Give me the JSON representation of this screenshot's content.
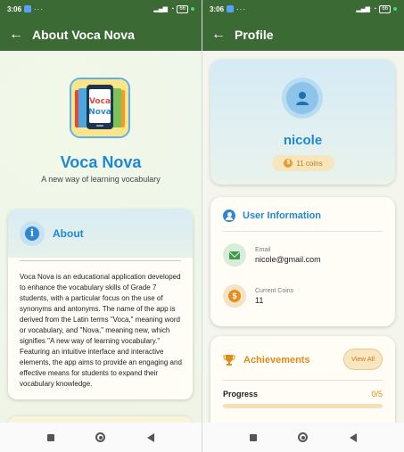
{
  "status_bar": {
    "time": "3:06",
    "battery": "66"
  },
  "about_screen": {
    "title": "About Voca Nova",
    "logo_text_line1": "Voca",
    "logo_text_line2": "Nova",
    "app_name": "Voca Nova",
    "tagline": "A new way of learning vocabulary",
    "about": {
      "heading": "About",
      "body": "Voca Nova is an educational application developed to enhance the vocabulary skills of Grade 7 students, with a particular focus on the use of synonyms and antonyms. The name of the app is derived from the Latin terms \"Voca,\" meaning word or vocabulary, and \"Nova,\" meaning new, which signifies \"A new way of learning vocabulary.\" Featuring an intuitive interface and interactive elements, the app aims to provide an engaging and effective means for students to expand their vocabulary knowledge."
    }
  },
  "profile_screen": {
    "title": "Profile",
    "username": "nicole",
    "coins_badge": "11 coins",
    "user_info": {
      "heading": "User Information",
      "email_label": "Email",
      "email_value": "nicole@gmail.com",
      "coins_label": "Current Coins",
      "coins_value": "11"
    },
    "achievements": {
      "heading": "Achievements",
      "view_all": "View All",
      "progress_label": "Progress",
      "progress_count": "0/5",
      "progress_fraction": 0
    }
  },
  "colors": {
    "app_bar": "#3c6a34",
    "primary_blue": "#1e88d2",
    "accent_orange": "#e38a17"
  },
  "icons": {
    "back": "arrow-left-icon",
    "info": "info-icon",
    "user": "user-icon",
    "mail": "mail-icon",
    "coin": "dollar-coin-icon",
    "trophy": "trophy-icon"
  }
}
